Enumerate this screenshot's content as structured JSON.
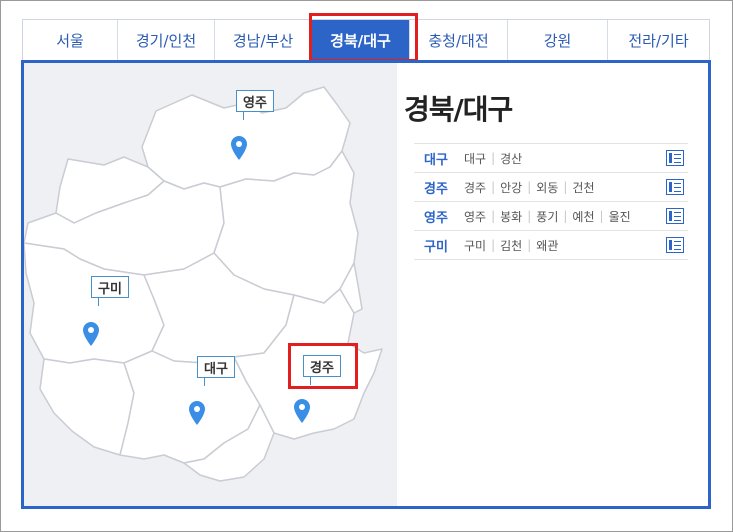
{
  "tabs": [
    {
      "label": "서울"
    },
    {
      "label": "경기/인천"
    },
    {
      "label": "경남/부산"
    },
    {
      "label": "경북/대구",
      "active": true
    },
    {
      "label": "충청/대전"
    },
    {
      "label": "강원"
    },
    {
      "label": "전라/기타"
    }
  ],
  "region_title": "경북/대구",
  "map_labels": {
    "yeongju": "영주",
    "gumi": "구미",
    "daegu": "대구",
    "gyeongju": "경주"
  },
  "cities": [
    {
      "name": "대구",
      "towns": [
        "대구",
        "경산"
      ]
    },
    {
      "name": "경주",
      "towns": [
        "경주",
        "안강",
        "외동",
        "건천"
      ]
    },
    {
      "name": "영주",
      "towns": [
        "영주",
        "봉화",
        "풍기",
        "예천",
        "울진"
      ]
    },
    {
      "name": "구미",
      "towns": [
        "구미",
        "김천",
        "왜관"
      ]
    }
  ],
  "colors": {
    "accent": "#2d64c8",
    "highlight": "#e21f1f",
    "pin": "#3a8ee6"
  }
}
